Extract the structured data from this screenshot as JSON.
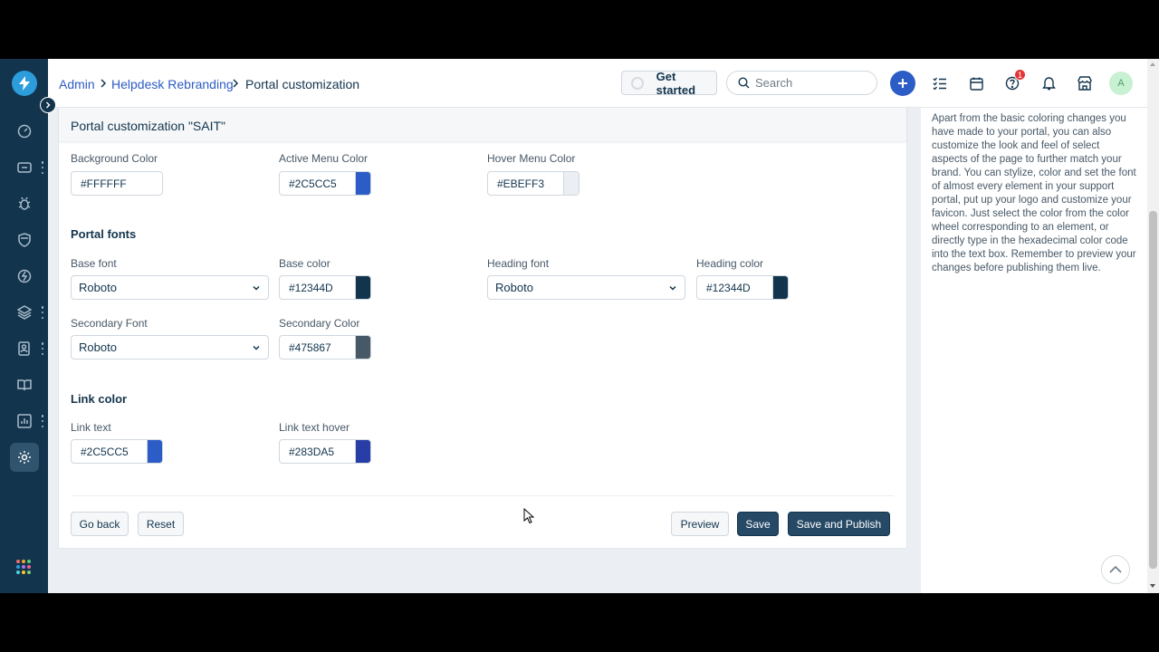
{
  "breadcrumb": {
    "items": [
      "Admin",
      "Helpdesk Rebranding"
    ],
    "current": "Portal customization"
  },
  "header": {
    "get_started_label": "Get started",
    "search_placeholder": "Search",
    "notification_count": "1",
    "avatar_initial": "A"
  },
  "page": {
    "title": "Portal customization \"SAIT\""
  },
  "menu_colors": {
    "background": {
      "label": "Background Color",
      "value": "#FFFFFF",
      "swatch": "#FFFFFF"
    },
    "active_menu": {
      "label": "Active Menu Color",
      "value": "#2C5CC5",
      "swatch": "#2C5CC5"
    },
    "hover_menu": {
      "label": "Hover Menu Color",
      "value": "#EBEFF3",
      "swatch": "#EBEFF3"
    }
  },
  "portal_fonts": {
    "title": "Portal fonts",
    "base_font": {
      "label": "Base font",
      "value": "Roboto"
    },
    "base_color": {
      "label": "Base color",
      "value": "#12344D",
      "swatch": "#12344D"
    },
    "heading_font": {
      "label": "Heading font",
      "value": "Roboto"
    },
    "heading_color": {
      "label": "Heading color",
      "value": "#12344D",
      "swatch": "#12344D"
    },
    "secondary_font": {
      "label": "Secondary Font",
      "value": "Roboto"
    },
    "secondary_color": {
      "label": "Secondary Color",
      "value": "#475867",
      "swatch": "#475867"
    }
  },
  "link_color": {
    "title": "Link color",
    "link_text": {
      "label": "Link text",
      "value": "#2C5CC5",
      "swatch": "#2C5CC5"
    },
    "link_text_hover": {
      "label": "Link text hover",
      "value": "#283DA5",
      "swatch": "#283DA5"
    }
  },
  "actions": {
    "go_back": "Go back",
    "reset": "Reset",
    "preview": "Preview",
    "save": "Save",
    "save_publish": "Save and Publish"
  },
  "help": {
    "text": "Apart from the basic coloring changes you have made to your portal, you can also customize the look and feel of select aspects of the page to further match your brand. You can stylize, color and set the font of almost every element in your support portal, put up your logo and customize your favicon. Just select the color from the color wheel corresponding to an element, or directly type in the hexadecimal color code into the text box. Remember to preview your changes before publishing them live."
  },
  "icons": {
    "sidebar": [
      "bolt-icon",
      "dashboard-icon",
      "tickets-icon",
      "bug-icon",
      "shield-icon",
      "lightning-icon",
      "layers-icon",
      "contacts-icon",
      "book-icon",
      "reports-icon",
      "settings-icon",
      "apps-grid-icon"
    ],
    "header": [
      "search-icon",
      "plus-icon",
      "checklist-icon",
      "calendar-icon",
      "help-icon",
      "bell-icon",
      "marketplace-icon"
    ]
  },
  "colors": {
    "sidebar_bg": "#12344D",
    "primary_button": "#264966",
    "link": "#2C5CC5"
  }
}
